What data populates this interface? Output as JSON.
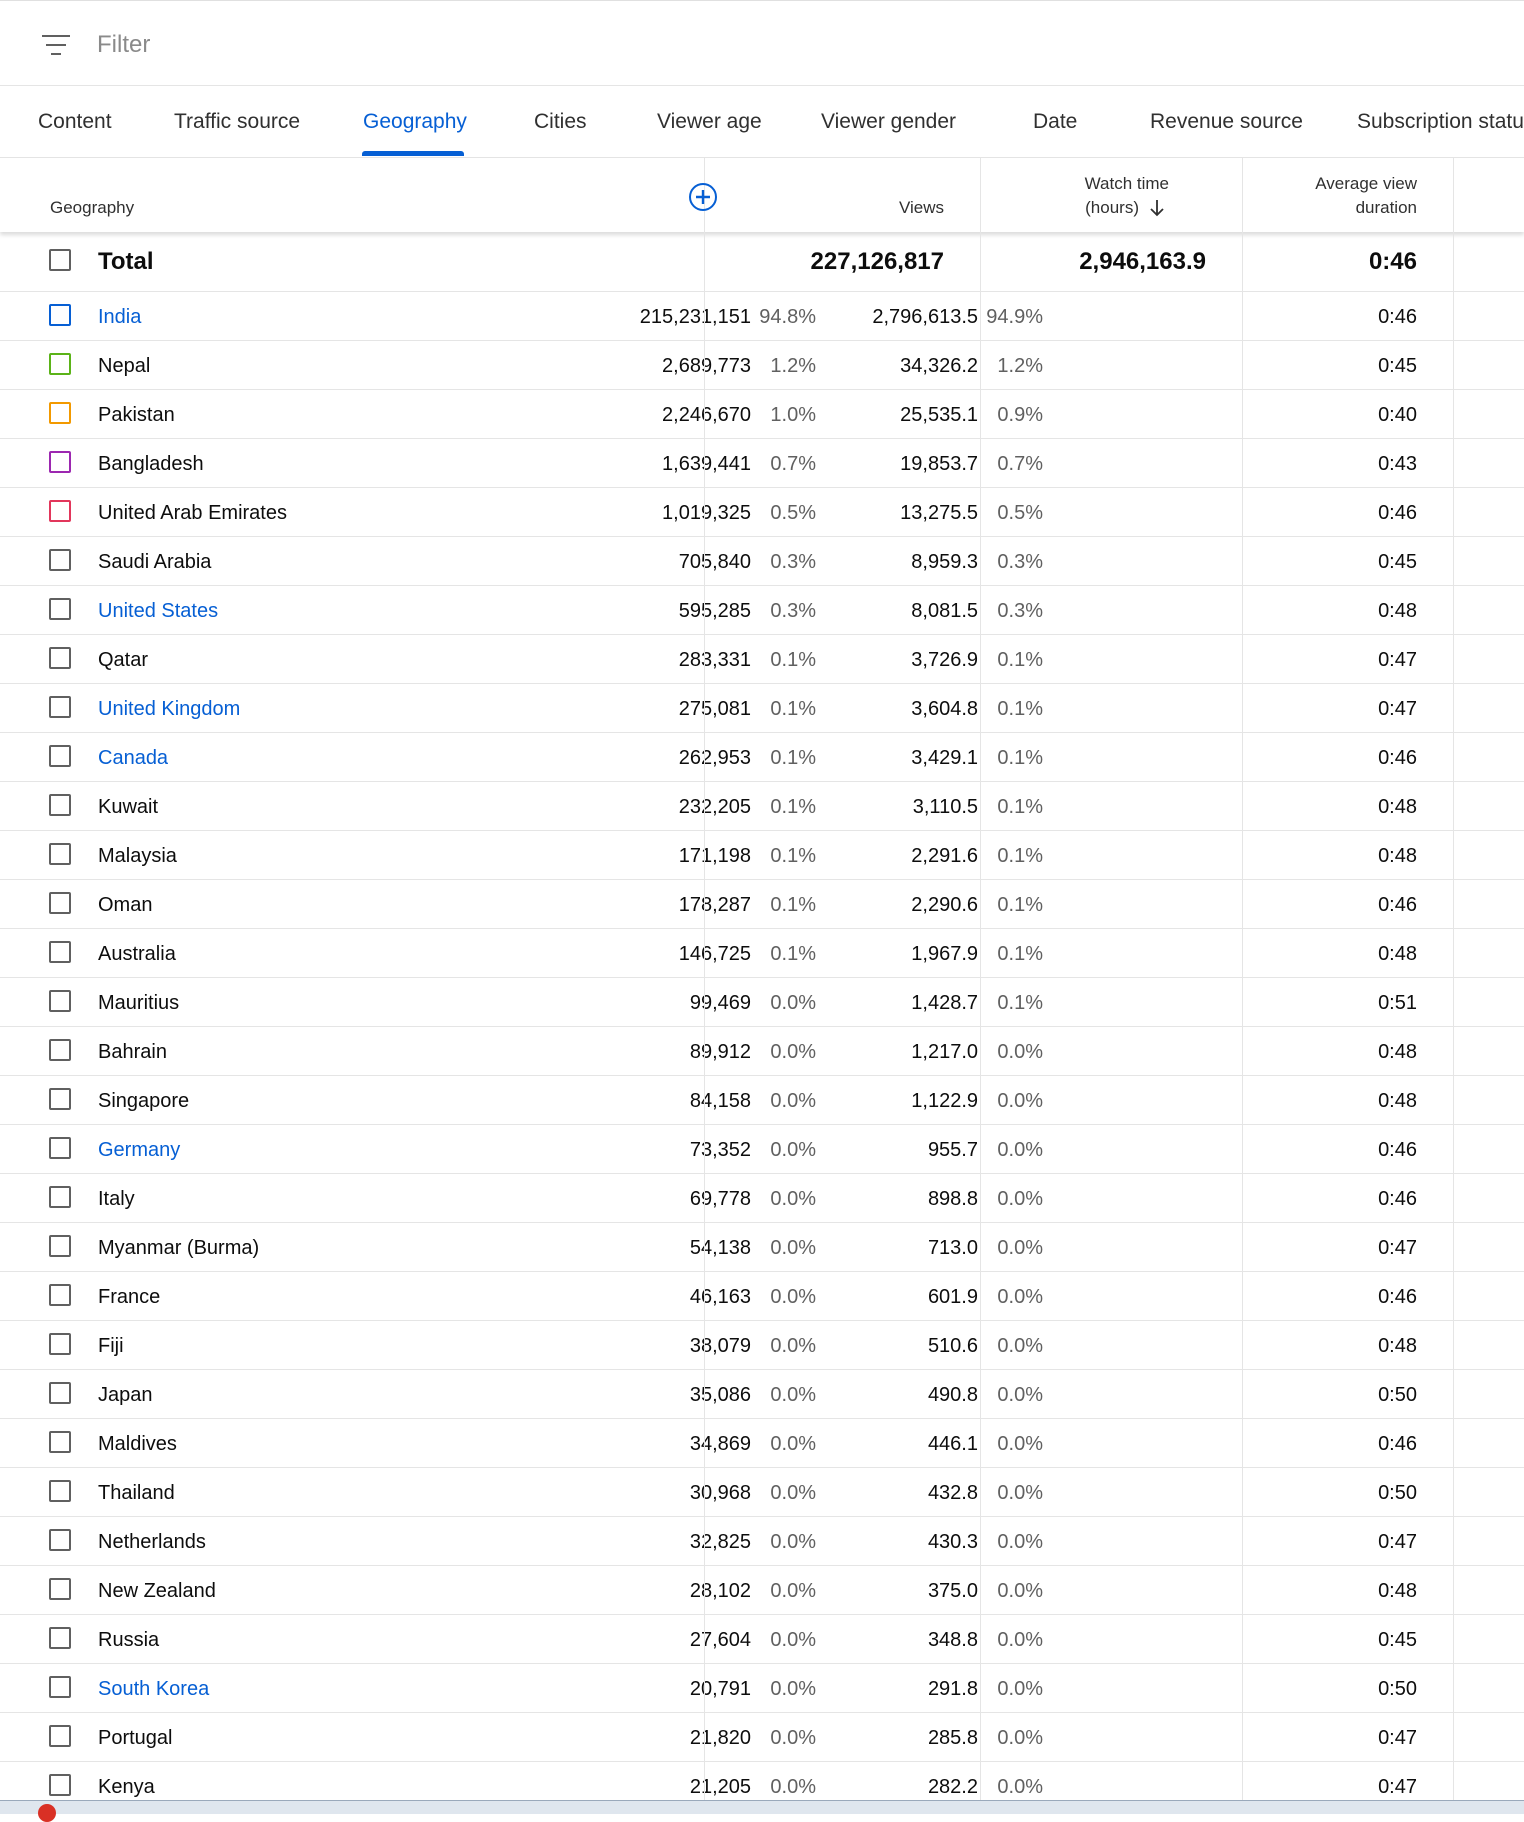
{
  "filter": {
    "placeholder": "Filter"
  },
  "tabs": [
    {
      "label": "Content",
      "active": false
    },
    {
      "label": "Traffic source",
      "active": false
    },
    {
      "label": "Geography",
      "active": true
    },
    {
      "label": "Cities",
      "active": false
    },
    {
      "label": "Viewer age",
      "active": false
    },
    {
      "label": "Viewer gender",
      "active": false
    },
    {
      "label": "Date",
      "active": false
    },
    {
      "label": "Revenue source",
      "active": false
    },
    {
      "label": "Subscription status",
      "active": false
    }
  ],
  "columns": {
    "geography": "Geography",
    "views": "Views",
    "watch_time_line1": "Watch time",
    "watch_time_line2": "(hours)",
    "avg_line1": "Average view",
    "avg_line2": "duration"
  },
  "total": {
    "label": "Total",
    "views": "227,126,817",
    "watch_time": "2,946,163.9",
    "avg": "0:46"
  },
  "rows": [
    {
      "name": "India",
      "link": true,
      "checkbox_color": "#065fd4",
      "views": "215,231,151",
      "views_pct": "94.8%",
      "watch": "2,796,613.5",
      "watch_pct": "94.9%",
      "avg": "0:46"
    },
    {
      "name": "Nepal",
      "link": false,
      "checkbox_color": "#5bb318",
      "views": "2,689,773",
      "views_pct": "1.2%",
      "watch": "34,326.2",
      "watch_pct": "1.2%",
      "avg": "0:45"
    },
    {
      "name": "Pakistan",
      "link": false,
      "checkbox_color": "#f29900",
      "views": "2,246,670",
      "views_pct": "1.0%",
      "watch": "25,535.1",
      "watch_pct": "0.9%",
      "avg": "0:40"
    },
    {
      "name": "Bangladesh",
      "link": false,
      "checkbox_color": "#9c27b0",
      "views": "1,639,441",
      "views_pct": "0.7%",
      "watch": "19,853.7",
      "watch_pct": "0.7%",
      "avg": "0:43"
    },
    {
      "name": "United Arab Emirates",
      "link": false,
      "checkbox_color": "#e2365b",
      "views": "1,019,325",
      "views_pct": "0.5%",
      "watch": "13,275.5",
      "watch_pct": "0.5%",
      "avg": "0:46"
    },
    {
      "name": "Saudi Arabia",
      "link": false,
      "views": "705,840",
      "views_pct": "0.3%",
      "watch": "8,959.3",
      "watch_pct": "0.3%",
      "avg": "0:45"
    },
    {
      "name": "United States",
      "link": true,
      "views": "595,285",
      "views_pct": "0.3%",
      "watch": "8,081.5",
      "watch_pct": "0.3%",
      "avg": "0:48"
    },
    {
      "name": "Qatar",
      "link": false,
      "views": "283,331",
      "views_pct": "0.1%",
      "watch": "3,726.9",
      "watch_pct": "0.1%",
      "avg": "0:47"
    },
    {
      "name": "United Kingdom",
      "link": true,
      "views": "275,081",
      "views_pct": "0.1%",
      "watch": "3,604.8",
      "watch_pct": "0.1%",
      "avg": "0:47"
    },
    {
      "name": "Canada",
      "link": true,
      "views": "262,953",
      "views_pct": "0.1%",
      "watch": "3,429.1",
      "watch_pct": "0.1%",
      "avg": "0:46"
    },
    {
      "name": "Kuwait",
      "link": false,
      "views": "232,205",
      "views_pct": "0.1%",
      "watch": "3,110.5",
      "watch_pct": "0.1%",
      "avg": "0:48"
    },
    {
      "name": "Malaysia",
      "link": false,
      "views": "171,198",
      "views_pct": "0.1%",
      "watch": "2,291.6",
      "watch_pct": "0.1%",
      "avg": "0:48"
    },
    {
      "name": "Oman",
      "link": false,
      "views": "178,287",
      "views_pct": "0.1%",
      "watch": "2,290.6",
      "watch_pct": "0.1%",
      "avg": "0:46"
    },
    {
      "name": "Australia",
      "link": false,
      "views": "146,725",
      "views_pct": "0.1%",
      "watch": "1,967.9",
      "watch_pct": "0.1%",
      "avg": "0:48"
    },
    {
      "name": "Mauritius",
      "link": false,
      "views": "99,469",
      "views_pct": "0.0%",
      "watch": "1,428.7",
      "watch_pct": "0.1%",
      "avg": "0:51"
    },
    {
      "name": "Bahrain",
      "link": false,
      "views": "89,912",
      "views_pct": "0.0%",
      "watch": "1,217.0",
      "watch_pct": "0.0%",
      "avg": "0:48"
    },
    {
      "name": "Singapore",
      "link": false,
      "views": "84,158",
      "views_pct": "0.0%",
      "watch": "1,122.9",
      "watch_pct": "0.0%",
      "avg": "0:48"
    },
    {
      "name": "Germany",
      "link": true,
      "views": "73,352",
      "views_pct": "0.0%",
      "watch": "955.7",
      "watch_pct": "0.0%",
      "avg": "0:46"
    },
    {
      "name": "Italy",
      "link": false,
      "views": "69,778",
      "views_pct": "0.0%",
      "watch": "898.8",
      "watch_pct": "0.0%",
      "avg": "0:46"
    },
    {
      "name": "Myanmar (Burma)",
      "link": false,
      "views": "54,138",
      "views_pct": "0.0%",
      "watch": "713.0",
      "watch_pct": "0.0%",
      "avg": "0:47"
    },
    {
      "name": "France",
      "link": false,
      "views": "46,163",
      "views_pct": "0.0%",
      "watch": "601.9",
      "watch_pct": "0.0%",
      "avg": "0:46"
    },
    {
      "name": "Fiji",
      "link": false,
      "views": "38,079",
      "views_pct": "0.0%",
      "watch": "510.6",
      "watch_pct": "0.0%",
      "avg": "0:48"
    },
    {
      "name": "Japan",
      "link": false,
      "views": "35,086",
      "views_pct": "0.0%",
      "watch": "490.8",
      "watch_pct": "0.0%",
      "avg": "0:50"
    },
    {
      "name": "Maldives",
      "link": false,
      "views": "34,869",
      "views_pct": "0.0%",
      "watch": "446.1",
      "watch_pct": "0.0%",
      "avg": "0:46"
    },
    {
      "name": "Thailand",
      "link": false,
      "views": "30,968",
      "views_pct": "0.0%",
      "watch": "432.8",
      "watch_pct": "0.0%",
      "avg": "0:50"
    },
    {
      "name": "Netherlands",
      "link": false,
      "views": "32,825",
      "views_pct": "0.0%",
      "watch": "430.3",
      "watch_pct": "0.0%",
      "avg": "0:47"
    },
    {
      "name": "New Zealand",
      "link": false,
      "views": "28,102",
      "views_pct": "0.0%",
      "watch": "375.0",
      "watch_pct": "0.0%",
      "avg": "0:48"
    },
    {
      "name": "Russia",
      "link": false,
      "views": "27,604",
      "views_pct": "0.0%",
      "watch": "348.8",
      "watch_pct": "0.0%",
      "avg": "0:45"
    },
    {
      "name": "South Korea",
      "link": true,
      "views": "20,791",
      "views_pct": "0.0%",
      "watch": "291.8",
      "watch_pct": "0.0%",
      "avg": "0:50"
    },
    {
      "name": "Portugal",
      "link": false,
      "views": "21,820",
      "views_pct": "0.0%",
      "watch": "285.8",
      "watch_pct": "0.0%",
      "avg": "0:47"
    },
    {
      "name": "Kenya",
      "link": false,
      "views": "21,205",
      "views_pct": "0.0%",
      "watch": "282.2",
      "watch_pct": "0.0%",
      "avg": "0:47"
    }
  ],
  "colors": {
    "accent": "#065fd4",
    "text": "#0d0d0d",
    "muted": "#606060"
  }
}
